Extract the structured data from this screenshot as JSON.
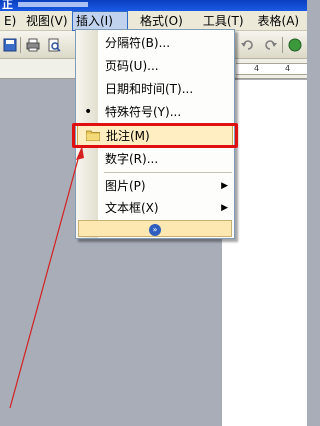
{
  "titlebar": {
    "title": "正"
  },
  "menubar": {
    "items": [
      {
        "label": "E)"
      },
      {
        "label": "视图(V)"
      },
      {
        "label": "插入(I)"
      },
      {
        "label": "格式(O)"
      },
      {
        "label": "工具(T)"
      },
      {
        "label": "表格(A)"
      }
    ]
  },
  "ruler": {
    "ticks": [
      "4",
      "4"
    ]
  },
  "insert_menu": {
    "items": [
      {
        "label": "分隔符(B)..."
      },
      {
        "label": "页码(U)..."
      },
      {
        "label": "日期和时间(T)..."
      },
      {
        "label": "特殊符号(Y)..."
      },
      {
        "label": "批注(M)"
      },
      {
        "label": "数字(R)..."
      },
      {
        "label": "图片(P)"
      },
      {
        "label": "文本框(X)"
      }
    ],
    "expand_glyph": "»"
  },
  "colors": {
    "highlight_box": "#e01010",
    "arrow": "#d42020",
    "menu_highlight": "#ffeec2",
    "titlebar": "#1a5ae6"
  },
  "icons": [
    "folder-icon",
    "bullet-icon",
    "submenu-arrow-icon",
    "expand-chevrons-icon"
  ]
}
